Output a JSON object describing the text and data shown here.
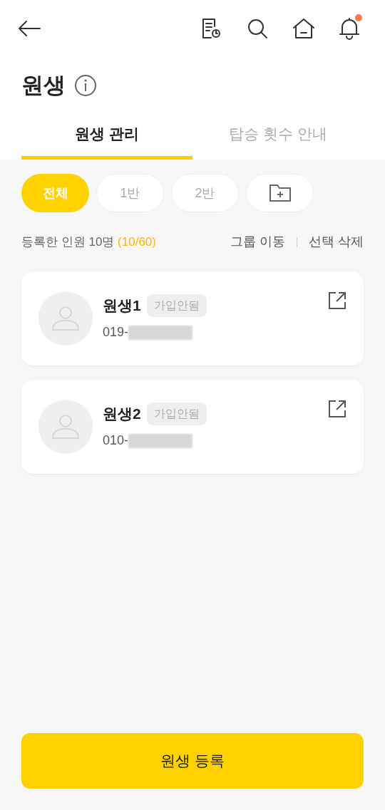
{
  "title": "원생",
  "tabs": [
    {
      "label": "원생 관리",
      "selected": true
    },
    {
      "label": "탑승 횟수 안내",
      "selected": false
    }
  ],
  "filters": [
    {
      "kind": "text",
      "label": "전체",
      "selected": true
    },
    {
      "kind": "text",
      "label": "1반",
      "selected": false
    },
    {
      "kind": "text",
      "label": "2반",
      "selected": false
    },
    {
      "kind": "add-folder",
      "selected": false
    }
  ],
  "summary": {
    "text": "등록한 인원 10명",
    "count": "(10/60)"
  },
  "actions": [
    "그룹 이동",
    "선택 삭제"
  ],
  "students": [
    {
      "name": "원생1",
      "status": "가입안됨",
      "phone": "019-"
    },
    {
      "name": "원생2",
      "status": "가입안됨",
      "phone": "010-"
    }
  ],
  "notification_dot": true,
  "register_button": "원생 등록"
}
